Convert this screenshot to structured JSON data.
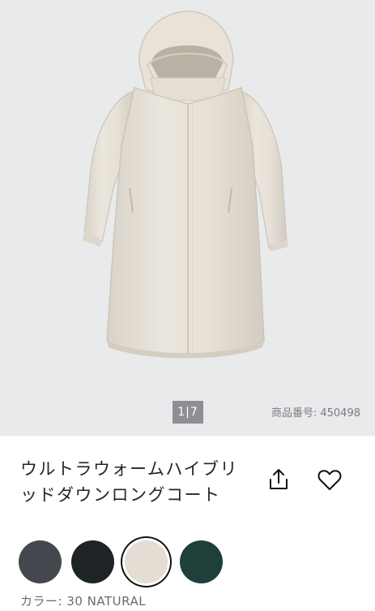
{
  "gallery": {
    "pager": "1|7",
    "product_number_label": "商品番号:",
    "product_number": "450498"
  },
  "product": {
    "title_line1": "ウルトラウォームハイブリ",
    "title_line2": "ッドダウンロングコート"
  },
  "actions": {
    "share_icon": "share-icon",
    "favorite_icon": "heart-icon"
  },
  "colors": {
    "swatches": [
      {
        "hex": "#45474f",
        "selected": false
      },
      {
        "hex": "#1e2325",
        "selected": false
      },
      {
        "hex": "#e3ddd3",
        "selected": true
      },
      {
        "hex": "#1f3f3a",
        "selected": false
      }
    ],
    "label": "カラー: 30 NATURAL"
  }
}
